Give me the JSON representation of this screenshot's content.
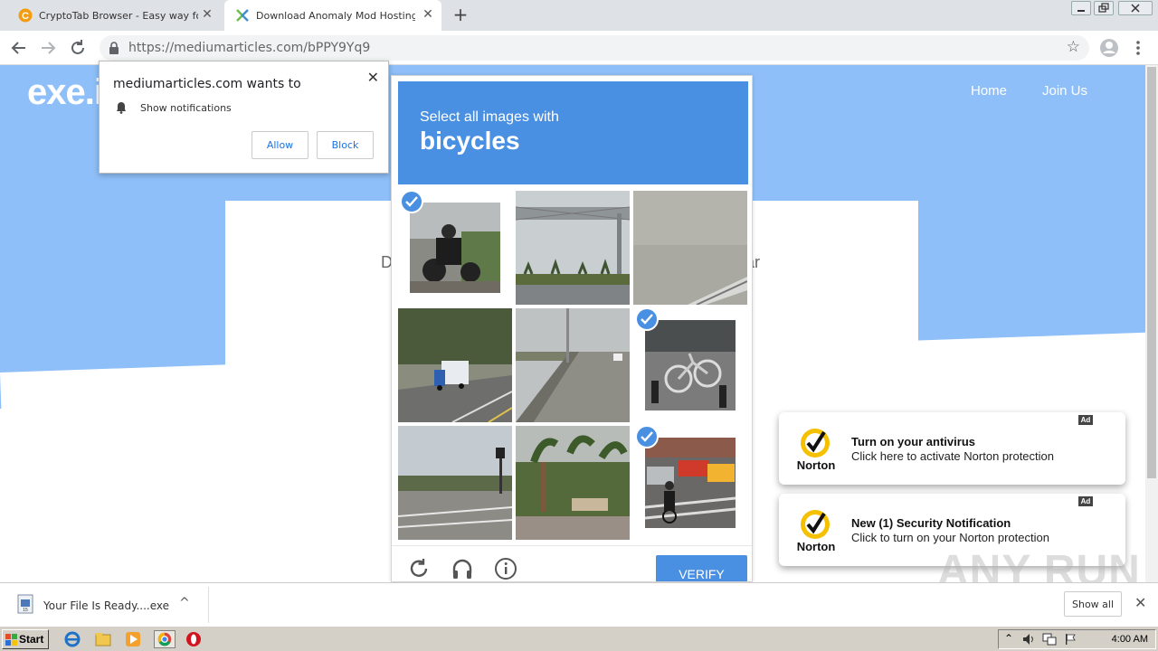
{
  "browser": {
    "tabs": [
      {
        "title": "CryptoTab Browser - Easy way for B",
        "active": false,
        "icon": "cryptotab-icon"
      },
      {
        "title": "Download Anomaly Mod Hosting mas",
        "active": true,
        "icon": "mediumarticles-icon"
      }
    ],
    "new_tab_glyph": "+",
    "url": "https://mediumarticles.com/bPPY9Yq9",
    "tab_close_glyph": "✕"
  },
  "page": {
    "logo": "exe.i",
    "nav": [
      "Home",
      "Join Us"
    ],
    "card_ghost_left": "D",
    "card_ghost_right": "ar"
  },
  "notification": {
    "heading": "mediumarticles.com wants to",
    "permission": "Show notifications",
    "allow": "Allow",
    "block": "Block",
    "close_glyph": "✕"
  },
  "captcha": {
    "prompt": "Select all images with",
    "target": "bicycles",
    "verify": "VERIFY",
    "tiles": [
      {
        "scene": "motorcycle-rider",
        "selected": true
      },
      {
        "scene": "highway-sign-gantry",
        "selected": false
      },
      {
        "scene": "pavement-closeup",
        "selected": false
      },
      {
        "scene": "truck-on-road",
        "selected": false
      },
      {
        "scene": "bridge-road",
        "selected": false
      },
      {
        "scene": "parked-bicycle",
        "selected": true
      },
      {
        "scene": "intersection",
        "selected": false
      },
      {
        "scene": "palm-trees-sign",
        "selected": false
      },
      {
        "scene": "cyclist-street",
        "selected": true
      }
    ],
    "footer_icons": [
      "reload-icon",
      "audio-icon",
      "info-icon"
    ]
  },
  "ads": [
    {
      "badge": "Ad",
      "title": "Turn on your antivirus",
      "body": "Click here to activate Norton protection",
      "logo_text": "Norton"
    },
    {
      "badge": "Ad",
      "title": "New (1) Security Notification",
      "body": "Click to turn on your Norton protection",
      "logo_text": "Norton"
    }
  ],
  "watermark": "ANY RUN",
  "download_bar": {
    "file": "Your File Is Ready....exe",
    "show_all": "Show all",
    "chevron": "^",
    "close_glyph": "✕"
  },
  "taskbar": {
    "start": "Start",
    "clock": "4:00 AM",
    "apps": [
      "ie-icon",
      "explorer-icon",
      "media-player-icon",
      "chrome-icon",
      "opera-icon"
    ]
  },
  "colors": {
    "captcha_blue": "#4a90e2",
    "hero_blue": "#8fbff8",
    "norton_yellow": "#f5c000"
  }
}
